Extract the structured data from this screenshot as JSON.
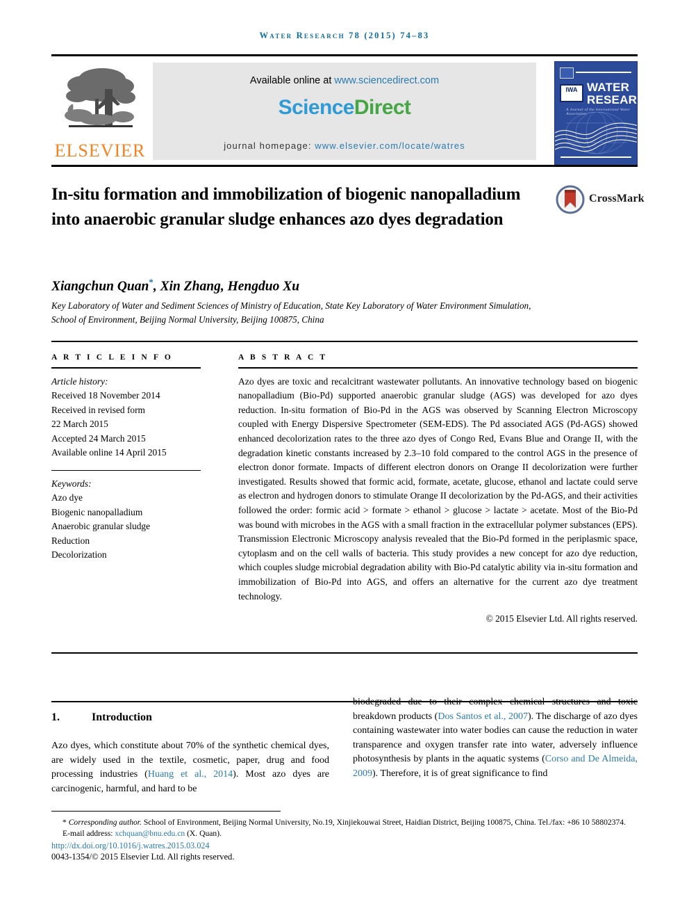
{
  "running_head": "Water Research 78 (2015) 74–83",
  "masthead": {
    "available_prefix": "Available online at ",
    "available_link": "www.sciencedirect.com",
    "sciencedirect_part1": "Science",
    "sciencedirect_part2": "Direct",
    "homepage_label": "journal homepage: ",
    "homepage_link": "www.elsevier.com/locate/watres",
    "publisher": "ELSEVIER",
    "cover": {
      "line1": "WATER",
      "line2": "RESEARCH",
      "subtitle": "A Journal of the International Water Association",
      "society": "IWA"
    }
  },
  "article": {
    "title": "In-situ formation and immobilization of biogenic nanopalladium into anaerobic granular sludge enhances azo dyes degradation",
    "crossmark_label": "CrossMark",
    "authors": "Xiangchun Quan",
    "authors_rest": ", Xin Zhang, Hengduo Xu",
    "corresponding_marker": "*",
    "affiliation": "Key Laboratory of Water and Sediment Sciences of Ministry of Education, State Key Laboratory of Water Environment Simulation, School of Environment, Beijing Normal University, Beijing 100875, China"
  },
  "article_info": {
    "heading": "A R T I C L E  I N F O",
    "history_label": "Article history:",
    "history": [
      "Received 18 November 2014",
      "Received in revised form",
      "22 March 2015",
      "Accepted 24 March 2015",
      "Available online 14 April 2015"
    ],
    "keywords_label": "Keywords:",
    "keywords": [
      "Azo dye",
      "Biogenic nanopalladium",
      "Anaerobic granular sludge",
      "Reduction",
      "Decolorization"
    ]
  },
  "abstract": {
    "heading": "A B S T R A C T",
    "text": "Azo dyes are toxic and recalcitrant wastewater pollutants. An innovative technology based on biogenic nanopalladium (Bio-Pd) supported anaerobic granular sludge (AGS) was developed for azo dyes reduction. In-situ formation of Bio-Pd in the AGS was observed by Scanning Electron Microscopy coupled with Energy Dispersive Spectrometer (SEM-EDS). The Pd associated AGS (Pd-AGS) showed enhanced decolorization rates to the three azo dyes of Congo Red, Evans Blue and Orange II, with the degradation kinetic constants increased by 2.3–10 fold compared to the control AGS in the presence of electron donor formate. Impacts of different electron donors on Orange II decolorization were further investigated. Results showed that formic acid, formate, acetate, glucose, ethanol and lactate could serve as electron and hydrogen donors to stimulate Orange II decolorization by the Pd-AGS, and their activities followed the order: formic acid > formate > ethanol > glucose > lactate > acetate. Most of the Bio-Pd was bound with microbes in the AGS with a small fraction in the extracellular polymer substances (EPS). Transmission Electronic Microscopy analysis revealed that the Bio-Pd formed in the periplasmic space, cytoplasm and on the cell walls of bacteria. This study provides a new concept for azo dye reduction, which couples sludge microbial degradation ability with Bio-Pd catalytic ability via in-situ formation and immobilization of Bio-Pd into AGS, and offers an alternative for the current azo dye treatment technology.",
    "copyright": "© 2015 Elsevier Ltd. All rights reserved."
  },
  "introduction": {
    "number": "1.",
    "heading": "Introduction",
    "left_text_a": "Azo dyes, which constitute about 70% of the synthetic chemical dyes, are widely used in the textile, cosmetic, paper, drug and food processing industries (",
    "left_cite_1": "Huang et al., 2014",
    "left_text_b": "). Most azo dyes are carcinogenic, harmful, and hard to be",
    "right_text_a": "biodegraded due to their complex chemical structures and toxic breakdown products (",
    "right_cite_1": "Dos Santos et al., 2007",
    "right_text_b": "). The discharge of azo dyes containing wastewater into water bodies can cause the reduction in water transparence and oxygen transfer rate into water, adversely influence photosynthesis by plants in the aquatic systems (",
    "right_cite_2": "Corso and De Almeida, 2009",
    "right_text_c": "). Therefore, it is of great significance to find"
  },
  "footnote": {
    "marker": "*",
    "corresponding_label": "Corresponding author.",
    "corresponding_address": " School of Environment, Beijing Normal University, No.19, Xinjiekouwai Street, Haidian District, Beijing 100875, China. Tel./fax: +86 10 58802374.",
    "email_label": "E-mail address: ",
    "email": "xchquan@bnu.edu.cn",
    "email_suffix": " (X. Quan).",
    "doi": "http://dx.doi.org/10.1016/j.watres.2015.03.024",
    "issn_line": "0043-1354/© 2015 Elsevier Ltd. All rights reserved."
  },
  "colors": {
    "link_blue": "#2a7ab0",
    "header_blue": "#0b6ea0",
    "elsevier_orange": "#f58220",
    "sciencedirect_blue": "#2f9bd6",
    "sciencedirect_green": "#46a544",
    "cover_blue": "#2c4b9b"
  }
}
